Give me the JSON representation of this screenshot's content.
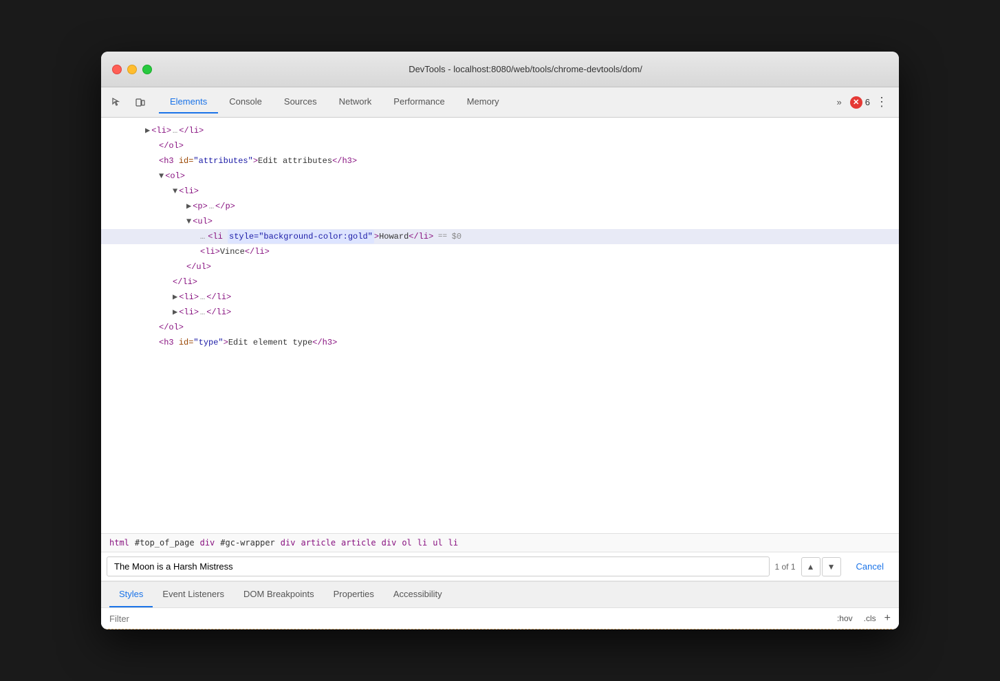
{
  "window": {
    "title": "DevTools - localhost:8080/web/tools/chrome-devtools/dom/"
  },
  "tabs": {
    "items": [
      {
        "label": "Elements",
        "active": true
      },
      {
        "label": "Console",
        "active": false
      },
      {
        "label": "Sources",
        "active": false
      },
      {
        "label": "Network",
        "active": false
      },
      {
        "label": "Performance",
        "active": false
      },
      {
        "label": "Memory",
        "active": false
      }
    ],
    "more_label": "»",
    "error_count": "6"
  },
  "dom": {
    "lines": [
      {
        "indent": 2,
        "html": "<span class='triangle'>▶</span><span class='tag'>&lt;li&gt;</span><span class='line-dots'>…</span><span class='tag'>&lt;/li&gt;</span>"
      },
      {
        "indent": 3,
        "html": "<span class='tag'>&lt;/ol&gt;</span>"
      },
      {
        "indent": 3,
        "html": "<span class='tag'>&lt;h3 </span><span class='attr-name'>id=</span><span class='attr-val'>\"attributes\"</span><span class='tag'>&gt;</span><span class='text-content'>Edit attributes</span><span class='tag'>&lt;/h3&gt;</span>"
      },
      {
        "indent": 3,
        "html": "<span class='triangle'>▼</span><span class='tag'>&lt;ol&gt;</span>"
      },
      {
        "indent": 4,
        "html": "<span class='triangle'>▼</span><span class='tag'>&lt;li&gt;</span>"
      },
      {
        "indent": 5,
        "html": "<span class='triangle'>▶</span><span class='tag'>&lt;p&gt;</span><span class='line-dots'>…</span><span class='tag'>&lt;/p&gt;</span>"
      },
      {
        "indent": 5,
        "html": "<span class='triangle'>▼</span><span class='tag'>&lt;ul&gt;</span>"
      },
      {
        "indent": 6,
        "html": "<span class='tag'>&lt;li </span><span class='attr-val'>style=\"background-color:gold\"</span><span class='tag'>&gt;</span><span class='text-content'>Howard</span><span class='tag'>&lt;/li&gt;</span><span class='equals'> == </span><span class='dollar'>$0</span>",
        "highlighted": true,
        "has_dots": true
      },
      {
        "indent": 6,
        "html": "<span class='tag'>&lt;li&gt;</span><span class='text-content'>Vince</span><span class='tag'>&lt;/li&gt;</span>"
      },
      {
        "indent": 5,
        "html": "<span class='tag'>&lt;/ul&gt;</span>"
      },
      {
        "indent": 4,
        "html": "<span class='tag'>&lt;/li&gt;</span>"
      },
      {
        "indent": 4,
        "html": "<span class='triangle'>▶</span><span class='tag'>&lt;li&gt;</span><span class='line-dots'>…</span><span class='tag'>&lt;/li&gt;</span>"
      },
      {
        "indent": 4,
        "html": "<span class='triangle'>▶</span><span class='tag'>&lt;li&gt;</span><span class='line-dots'>…</span><span class='tag'>&lt;/li&gt;</span>"
      },
      {
        "indent": 3,
        "html": "<span class='tag'>&lt;/ol&gt;</span>"
      },
      {
        "indent": 3,
        "html": "<span class='tag'>&lt;h3 </span><span class='attr-name'>id=</span><span class='attr-val'>\"type\"</span><span class='tag'>&gt;</span><span class='text-content'>Edit element type</span><span class='tag'>&lt;/h3&gt;</span>"
      }
    ]
  },
  "breadcrumb": {
    "items": [
      {
        "label": "html",
        "type": "tag"
      },
      {
        "label": "#top_of_page",
        "type": "id"
      },
      {
        "label": "div",
        "type": "tag"
      },
      {
        "label": "#gc-wrapper",
        "type": "id"
      },
      {
        "label": "div",
        "type": "tag"
      },
      {
        "label": "article",
        "type": "tag"
      },
      {
        "label": "article",
        "type": "tag"
      },
      {
        "label": "div",
        "type": "tag"
      },
      {
        "label": "ol",
        "type": "tag"
      },
      {
        "label": "li",
        "type": "tag"
      },
      {
        "label": "ul",
        "type": "tag"
      },
      {
        "label": "li",
        "type": "tag"
      }
    ]
  },
  "search": {
    "value": "The Moon is a Harsh Mistress",
    "count": "1 of 1",
    "cancel_label": "Cancel",
    "up_arrow": "▲",
    "down_arrow": "▼"
  },
  "panel": {
    "tabs": [
      {
        "label": "Styles",
        "active": true
      },
      {
        "label": "Event Listeners",
        "active": false
      },
      {
        "label": "DOM Breakpoints",
        "active": false
      },
      {
        "label": "Properties",
        "active": false
      },
      {
        "label": "Accessibility",
        "active": false
      }
    ],
    "filter": {
      "placeholder": "Filter",
      "pseudo_label": ":hov",
      "cls_label": ".cls",
      "add_label": "+"
    }
  }
}
